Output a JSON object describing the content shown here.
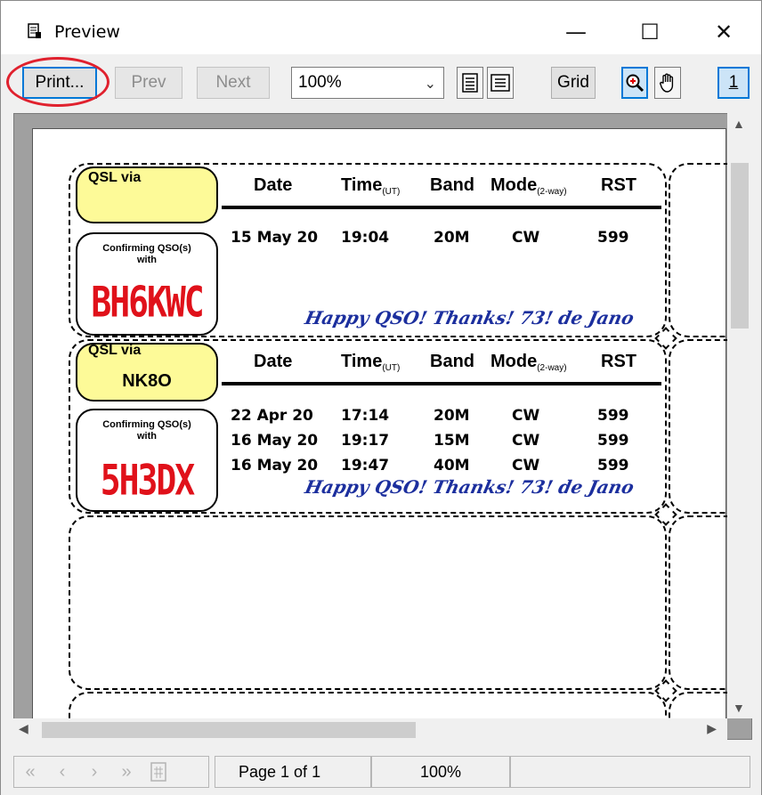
{
  "window": {
    "title": "Preview",
    "controls": {
      "minimize": "—",
      "maximize": "☐",
      "close": "✕"
    }
  },
  "toolbar": {
    "print_label": "Print...",
    "prev_label": "Prev",
    "next_label": "Next",
    "zoom_value": "100%",
    "grid_label": "Grid",
    "onepage_label": "1"
  },
  "cards": [
    {
      "via_label": "QSL via",
      "via_call": "",
      "headers": {
        "date": "Date",
        "time": "Time",
        "time_sub": "(UT)",
        "band": "Band",
        "mode": "Mode",
        "mode_sub": "(2-way)",
        "rst": "RST"
      },
      "confirm_label_line1": "Confirming QSO(s)",
      "confirm_label_line2": "with",
      "callsign": "BH6KWC",
      "qsos": [
        {
          "date": "15 May 20",
          "time": "19:04",
          "band": "20M",
          "mode": "CW",
          "rst": "599"
        }
      ],
      "signoff": "Happy QSO! Thanks! 73! de Jano"
    },
    {
      "via_label": "QSL via",
      "via_call": "NK8O",
      "headers": {
        "date": "Date",
        "time": "Time",
        "time_sub": "(UT)",
        "band": "Band",
        "mode": "Mode",
        "mode_sub": "(2-way)",
        "rst": "RST"
      },
      "confirm_label_line1": "Confirming QSO(s)",
      "confirm_label_line2": "with",
      "callsign": "5H3DX",
      "qsos": [
        {
          "date": "22 Apr 20",
          "time": "17:14",
          "band": "20M",
          "mode": "CW",
          "rst": "599"
        },
        {
          "date": "16 May 20",
          "time": "19:17",
          "band": "15M",
          "mode": "CW",
          "rst": "599"
        },
        {
          "date": "16 May 20",
          "time": "19:47",
          "band": "40M",
          "mode": "CW",
          "rst": "599"
        }
      ],
      "signoff": "Happy QSO! Thanks! 73! de Jano"
    }
  ],
  "statusbar": {
    "page_text": "Page 1 of 1",
    "zoom_text": "100%"
  }
}
